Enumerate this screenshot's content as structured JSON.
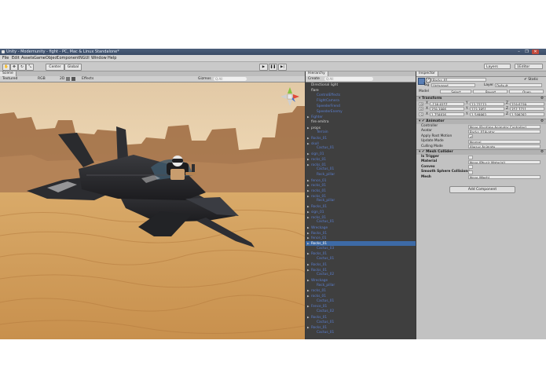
{
  "window": {
    "title": "Unity - Modernunity - fight - PC, Mac & Linux Standalone*",
    "controls": [
      "–",
      "❐",
      "✕"
    ]
  },
  "menu": [
    "File",
    "Edit",
    "Assets",
    "GameObject",
    "Component",
    "NGUI",
    "Window",
    "Help"
  ],
  "toolbar": {
    "center_label": "Center",
    "global_label": "Global",
    "layers_label": "Layers",
    "layout_label": "1Editor"
  },
  "scene": {
    "tab_label": "Scene",
    "mode_label": "Textured",
    "rgb_label": "RGB",
    "view_2d": "2D",
    "effects_label": "Effects",
    "gizmos_label": "Gizmos",
    "search_placeholder": "Q:All"
  },
  "hierarchy": {
    "tab_label": "Hierarchy",
    "create_label": "Create",
    "search_placeholder": "Q:All",
    "items": [
      {
        "label": "Directional light",
        "indent": 0,
        "arrow": false,
        "color": "#d8d8d8"
      },
      {
        "label": "flare",
        "indent": 0,
        "arrow": false,
        "color": "#d8d8d8"
      },
      {
        "label": "ControlEffects",
        "indent": 1,
        "arrow": false,
        "color": "#5b7fd0"
      },
      {
        "label": "FlightCamera",
        "indent": 1,
        "arrow": false,
        "color": "#5b7fd0"
      },
      {
        "label": "SpeederFrend",
        "indent": 1,
        "arrow": false,
        "color": "#5b7fd0"
      },
      {
        "label": "SpeederEnemy",
        "indent": 1,
        "arrow": false,
        "color": "#5b7fd0"
      },
      {
        "label": "Fighter",
        "indent": 0,
        "arrow": true,
        "color": "#5b7fd0"
      },
      {
        "label": "fire emitra",
        "indent": 0,
        "arrow": false,
        "color": "#d8d8d8"
      },
      {
        "label": "props",
        "indent": 0,
        "arrow": true,
        "color": "#d8d8d8"
      },
      {
        "label": "Terrain",
        "indent": 1,
        "arrow": false,
        "color": "#5b7fd0"
      },
      {
        "label": "Rocks_01",
        "indent": 0,
        "arrow": true,
        "color": "#5b7fd0"
      },
      {
        "label": "skull",
        "indent": 0,
        "arrow": true,
        "color": "#5b7fd0"
      },
      {
        "label": "Cactus_01",
        "indent": 1,
        "arrow": false,
        "color": "#5b7fd0"
      },
      {
        "label": "sign_01",
        "indent": 0,
        "arrow": true,
        "color": "#5b7fd0"
      },
      {
        "label": "rocks_01",
        "indent": 0,
        "arrow": true,
        "color": "#5b7fd0"
      },
      {
        "label": "rocks_01",
        "indent": 0,
        "arrow": true,
        "color": "#5b7fd0"
      },
      {
        "label": "Cactus_01",
        "indent": 1,
        "arrow": false,
        "color": "#5b7fd0"
      },
      {
        "label": "Rock_pillar",
        "indent": 1,
        "arrow": false,
        "color": "#5b7fd0"
      },
      {
        "label": "fence_01",
        "indent": 0,
        "arrow": true,
        "color": "#5b7fd0"
      },
      {
        "label": "rocks_01",
        "indent": 0,
        "arrow": true,
        "color": "#5b7fd0"
      },
      {
        "label": "rocks_01",
        "indent": 0,
        "arrow": true,
        "color": "#5b7fd0"
      },
      {
        "label": "rocks_01",
        "indent": 0,
        "arrow": true,
        "color": "#5b7fd0"
      },
      {
        "label": "Rock_pillar",
        "indent": 1,
        "arrow": false,
        "color": "#5b7fd0"
      },
      {
        "label": "Rocks_01",
        "indent": 0,
        "arrow": true,
        "color": "#5b7fd0"
      },
      {
        "label": "sign_01",
        "indent": 0,
        "arrow": true,
        "color": "#5b7fd0"
      },
      {
        "label": "rocks_01",
        "indent": 0,
        "arrow": true,
        "color": "#5b7fd0"
      },
      {
        "label": "Cactus_01",
        "indent": 1,
        "arrow": false,
        "color": "#5b7fd0"
      },
      {
        "label": "Wreckage",
        "indent": 0,
        "arrow": true,
        "color": "#5b7fd0"
      },
      {
        "label": "Rocks_01",
        "indent": 0,
        "arrow": true,
        "color": "#5b7fd0"
      },
      {
        "label": "fence_01",
        "indent": 0,
        "arrow": true,
        "color": "#5b7fd0"
      },
      {
        "label": "Rocks_01",
        "indent": 0,
        "arrow": true,
        "color": "#ffffff",
        "selected": true
      },
      {
        "label": "Cactus_03",
        "indent": 1,
        "arrow": false,
        "color": "#5b7fd0"
      },
      {
        "label": "Rocks_01",
        "indent": 0,
        "arrow": true,
        "color": "#5b7fd0"
      },
      {
        "label": "Cactus_01",
        "indent": 1,
        "arrow": false,
        "color": "#5b7fd0"
      },
      {
        "label": "Rocks_01",
        "indent": 0,
        "arrow": true,
        "color": "#5b7fd0"
      },
      {
        "label": "Rocks_01",
        "indent": 0,
        "arrow": true,
        "color": "#5b7fd0"
      },
      {
        "label": "Cactus_02",
        "indent": 1,
        "arrow": false,
        "color": "#5b7fd0"
      },
      {
        "label": "Wreckage",
        "indent": 0,
        "arrow": true,
        "color": "#5b7fd0"
      },
      {
        "label": "Rock_pillar",
        "indent": 1,
        "arrow": false,
        "color": "#5b7fd0"
      },
      {
        "label": "rocks_01",
        "indent": 0,
        "arrow": true,
        "color": "#5b7fd0"
      },
      {
        "label": "rocks_01",
        "indent": 0,
        "arrow": true,
        "color": "#5b7fd0"
      },
      {
        "label": "Cactus_01",
        "indent": 1,
        "arrow": false,
        "color": "#5b7fd0"
      },
      {
        "label": "Fence_01",
        "indent": 0,
        "arrow": true,
        "color": "#5b7fd0"
      },
      {
        "label": "Cactus_02",
        "indent": 1,
        "arrow": false,
        "color": "#5b7fd0"
      },
      {
        "label": "Rocks_01",
        "indent": 0,
        "arrow": true,
        "color": "#5b7fd0"
      },
      {
        "label": "Cactus_01",
        "indent": 1,
        "arrow": false,
        "color": "#5b7fd0"
      },
      {
        "label": "Rocks_01",
        "indent": 0,
        "arrow": true,
        "color": "#5b7fd0"
      },
      {
        "label": "Cactus_01",
        "indent": 1,
        "arrow": false,
        "color": "#5b7fd0"
      }
    ]
  },
  "inspector": {
    "tab_label": "Inspector",
    "object_name": "Rocks_01",
    "static_label": "Static",
    "tag_label": "Tag",
    "tag_value": "Untagged",
    "layer_label": "Layer",
    "layer_value": "Default",
    "model_label": "Model",
    "select_label": "Select",
    "revert_label": "Revert",
    "open_label": "Open",
    "transform": {
      "title": "Transform",
      "rows": [
        {
          "label": "P",
          "x": "-138.8357",
          "y": "13.22123",
          "z": "219.6239"
        },
        {
          "label": "R",
          "x": "359.3986",
          "y": "123.3951",
          "z": "357.7711"
        },
        {
          "label": "S",
          "x": "1.758836",
          "y": "1.549983",
          "z": "1.599282"
        }
      ]
    },
    "animator": {
      "title": "Animator",
      "rows": [
        {
          "label": "Controller",
          "value": "None (Runtime Animator Controller)"
        },
        {
          "label": "Avatar",
          "value": "Rocks_01Avatar"
        },
        {
          "label": "Apply Root Motion",
          "value": "✔"
        },
        {
          "label": "Update Mode",
          "value": "Normal"
        },
        {
          "label": "Culling Mode",
          "value": "Always Animate"
        }
      ]
    },
    "mesh_collider": {
      "title": "Mesh Collider",
      "rows": [
        {
          "label": "Is Trigger",
          "value": ""
        },
        {
          "label": "Material",
          "value": "None (Physic Material)"
        },
        {
          "label": "Convex",
          "value": ""
        },
        {
          "label": "Smooth Sphere Collisions",
          "value": ""
        },
        {
          "label": "Mesh",
          "value": "None (Mesh)"
        }
      ]
    },
    "add_component_label": "Add Component"
  },
  "colors": {
    "selection": "#3d6aa6",
    "hierarchy_bg": "#3f3f3f",
    "inspector_bg": "#c2c2c2"
  }
}
